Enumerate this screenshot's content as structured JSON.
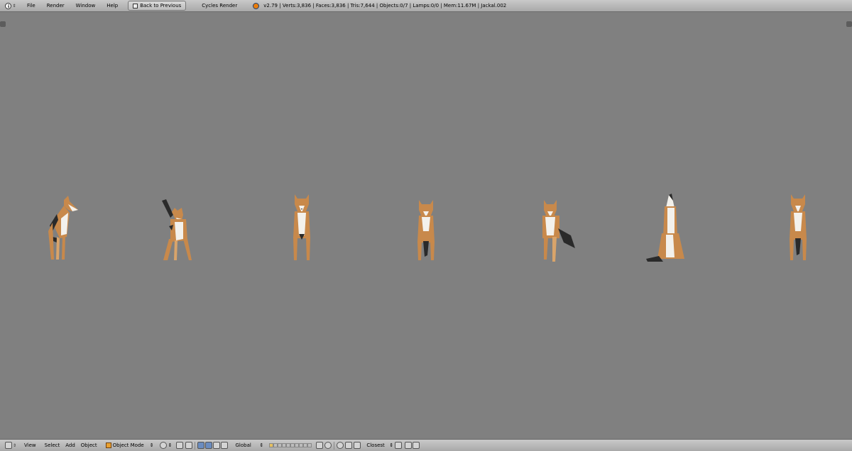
{
  "topbar": {
    "editor_icon": "info-icon",
    "menus": [
      "File",
      "Render",
      "Window",
      "Help"
    ],
    "back_button": "Back to Previous",
    "render_engine": "Cycles Render",
    "stats": "v2.79 | Verts:3,836 | Faces:3,836 | Tris:7,644 | Objects:0/7 | Lamps:0/0 | Mem:11.67M | Jackal.002"
  },
  "viewport": {
    "background": "#808080",
    "models": [
      "jackal-looking-side",
      "jackal-tail-raised",
      "jackal-standing",
      "jackal-standing-2",
      "jackal-stepping",
      "jackal-howling",
      "jackal-standing-3"
    ]
  },
  "bottombar": {
    "menus": [
      "View",
      "Select",
      "Add",
      "Object"
    ],
    "mode": "Object Mode",
    "orientation": "Global",
    "snap_target": "Closest"
  },
  "colors": {
    "fur": "#c8894b",
    "white": "#f3f1ec",
    "dark": "#2a2a2a",
    "header": "#b4b4b4"
  }
}
